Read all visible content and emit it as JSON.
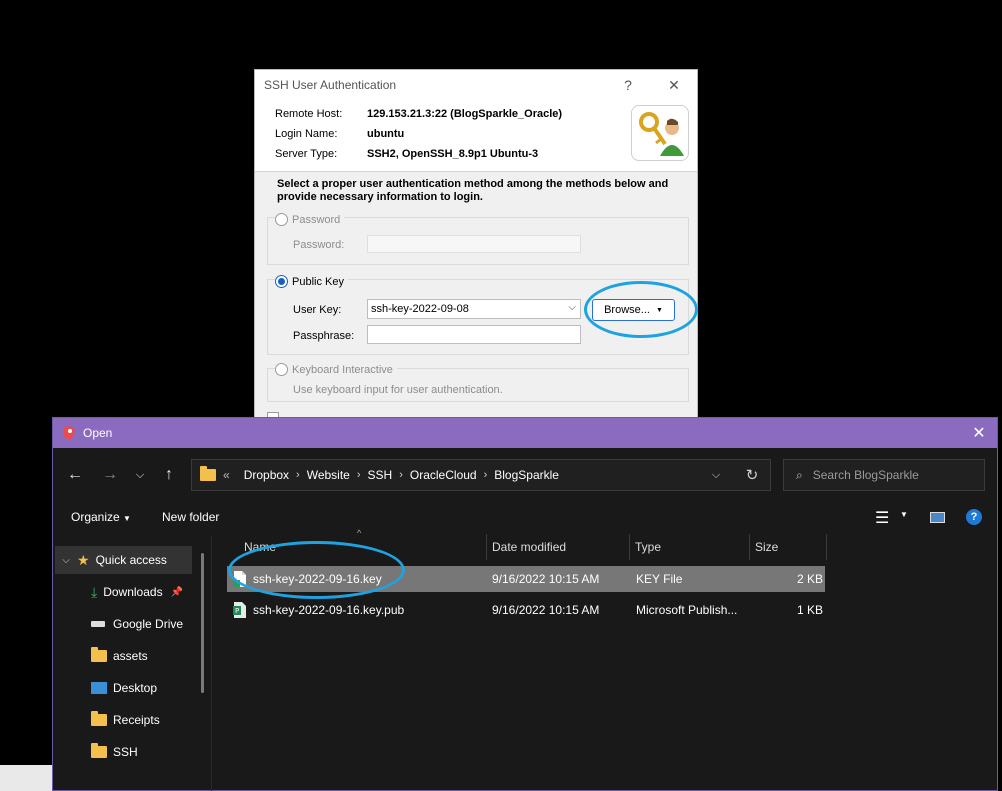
{
  "ssh_dialog": {
    "title": "SSH User Authentication",
    "help": "?",
    "close": "✕",
    "remote_host_label": "Remote Host:",
    "remote_host": "129.153.21.3:22 (BlogSparkle_Oracle)",
    "login_name_label": "Login Name:",
    "login_name": "ubuntu",
    "server_type_label": "Server Type:",
    "server_type": "SSH2, OpenSSH_8.9p1 Ubuntu-3",
    "description": "Select a proper user authentication method among the methods below and provide necessary information to login.",
    "password_option": "Password",
    "password_label": "Password:",
    "password_value": "",
    "public_key_option": "Public Key",
    "user_key_label": "User Key:",
    "user_key_value": "ssh-key-2022-09-08",
    "passphrase_label": "Passphrase:",
    "passphrase_value": "",
    "browse_label": "Browse...",
    "keyboard_option": "Keyboard Interactive",
    "keyboard_hint": "Use keyboard input for user authentication.",
    "selected_method": "Public Key"
  },
  "open_dialog": {
    "title": "Open",
    "breadcrumb": [
      "Dropbox",
      "Website",
      "SSH",
      "OracleCloud",
      "BlogSparkle"
    ],
    "breadcrumb_overflow": "«",
    "search_placeholder": "Search BlogSparkle",
    "organize_label": "Organize",
    "new_folder_label": "New folder",
    "columns": {
      "name": "Name",
      "date": "Date modified",
      "type": "Type",
      "size": "Size"
    },
    "nav_items": [
      {
        "label": "Quick access",
        "icon": "star-icon"
      },
      {
        "label": "Downloads",
        "icon": "download-icon",
        "pinned": true
      },
      {
        "label": "Google Drive",
        "icon": "drive-icon",
        "pinned": true
      },
      {
        "label": "assets",
        "icon": "folder-icon"
      },
      {
        "label": "Desktop",
        "icon": "desktop-icon"
      },
      {
        "label": "Receipts",
        "icon": "folder-icon"
      },
      {
        "label": "SSH",
        "icon": "folder-icon"
      }
    ],
    "files": [
      {
        "name": "ssh-key-2022-09-16.key",
        "date": "9/16/2022 10:15 AM",
        "type": "KEY File",
        "size": "2 KB",
        "selected": true
      },
      {
        "name": "ssh-key-2022-09-16.key.pub",
        "date": "9/16/2022 10:15 AM",
        "type": "Microsoft Publish...",
        "size": "1 KB",
        "selected": false
      }
    ]
  },
  "colors": {
    "open_titlebar": "#8b6bbf",
    "highlight_circle": "#1ea3e0",
    "radio_selected": "#1a5fbf"
  }
}
